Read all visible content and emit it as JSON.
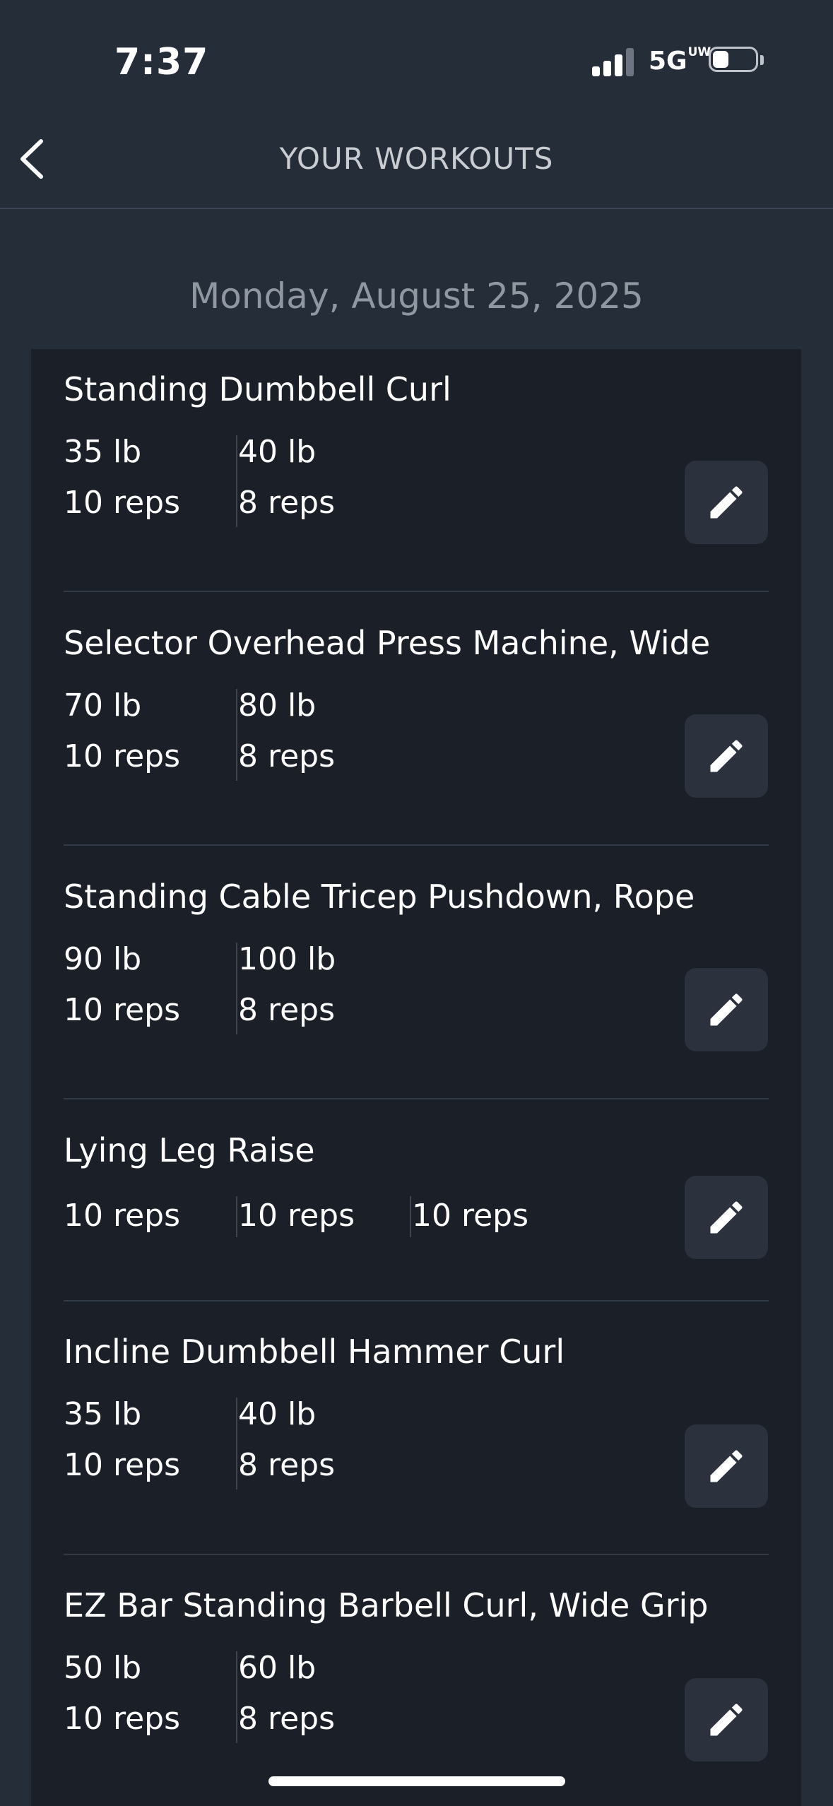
{
  "status_bar": {
    "time": "7:37",
    "network": "5G",
    "network_sup": "UW"
  },
  "header": {
    "title": "YOUR WORKOUTS"
  },
  "date": "Monday, August 25, 2025",
  "workouts": [
    {
      "name": "Standing Dumbbell Curl",
      "sets": [
        {
          "weight": "35 lb",
          "reps": "10 reps"
        },
        {
          "weight": "40 lb",
          "reps": "8 reps"
        }
      ]
    },
    {
      "name": "Selector Overhead Press Machine, Wide",
      "sets": [
        {
          "weight": "70 lb",
          "reps": "10 reps"
        },
        {
          "weight": "80 lb",
          "reps": "8 reps"
        }
      ]
    },
    {
      "name": "Standing Cable Tricep Pushdown, Rope",
      "sets": [
        {
          "weight": "90 lb",
          "reps": "10 reps"
        },
        {
          "weight": "100 lb",
          "reps": "8 reps"
        }
      ]
    },
    {
      "name": "Lying Leg Raise",
      "sets": [
        {
          "reps": "10 reps"
        },
        {
          "reps": "10 reps"
        },
        {
          "reps": "10 reps"
        }
      ]
    },
    {
      "name": "Incline Dumbbell Hammer Curl",
      "sets": [
        {
          "weight": "35 lb",
          "reps": "10 reps"
        },
        {
          "weight": "40 lb",
          "reps": "8 reps"
        }
      ]
    },
    {
      "name": "EZ Bar Standing Barbell Curl, Wide Grip",
      "sets": [
        {
          "weight": "50 lb",
          "reps": "10 reps"
        },
        {
          "weight": "60 lb",
          "reps": "8 reps"
        }
      ]
    }
  ]
}
